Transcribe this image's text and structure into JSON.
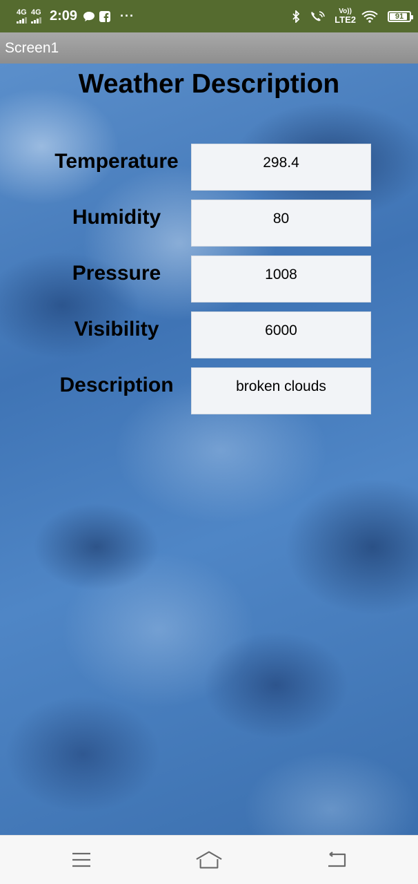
{
  "status_bar": {
    "network_1": "4G",
    "network_2": "4G",
    "time": "2:09",
    "volte_top": "Vo))",
    "volte_bottom": "LTE2",
    "battery": "91",
    "icons": [
      "signal-icon",
      "chat-icon",
      "facebook-icon",
      "more-dots-icon",
      "bluetooth-icon",
      "wifi-call-icon",
      "wifi-icon",
      "battery-icon"
    ]
  },
  "title_bar": {
    "title": "Screen1"
  },
  "main": {
    "heading": "Weather Description",
    "rows": [
      {
        "label": "Temperature",
        "value": "298.4"
      },
      {
        "label": "Humidity",
        "value": "80"
      },
      {
        "label": "Pressure",
        "value": "1008"
      },
      {
        "label": "Visibility",
        "value": "6000"
      },
      {
        "label": "Description",
        "value": "broken clouds"
      }
    ]
  },
  "nav_bar": {
    "icons": [
      "menu-icon",
      "home-icon",
      "back-icon"
    ]
  }
}
